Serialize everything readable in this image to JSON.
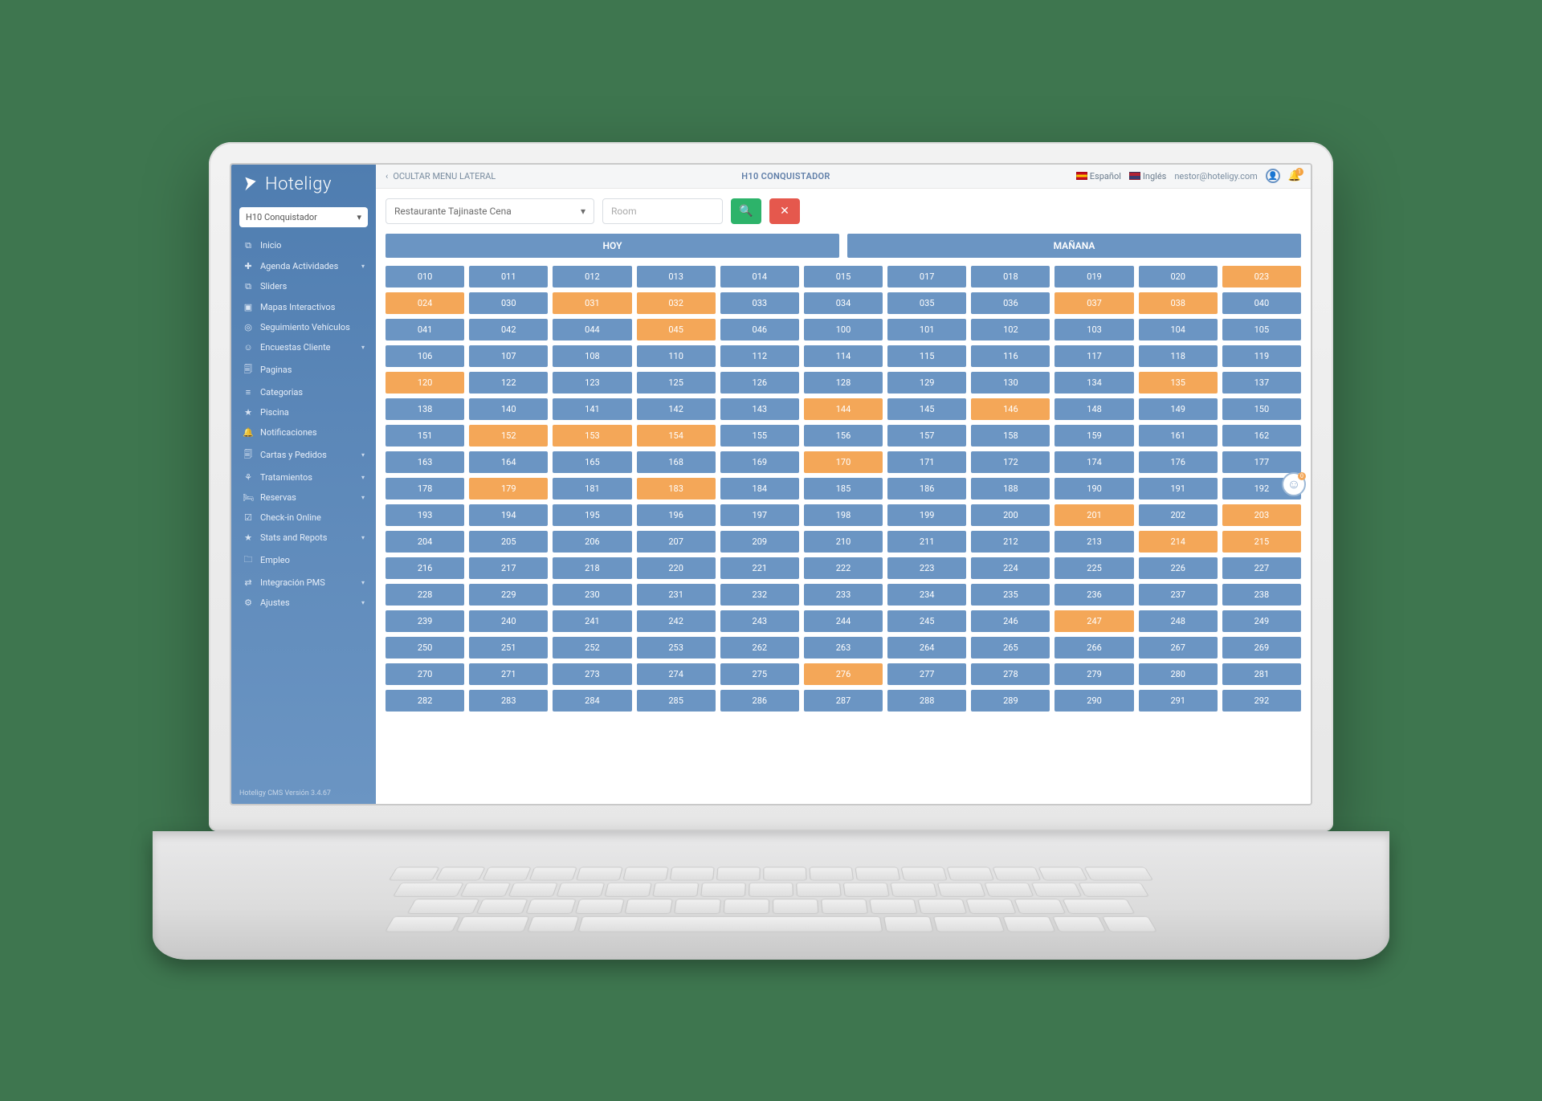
{
  "brand": "Hoteligy",
  "hotel_selector": "H10 Conquistador",
  "version": "Hoteligy CMS Versión 3.4.67",
  "topbar": {
    "toggle_label": "OCULTAR MENU LATERAL",
    "title": "H10 CONQUISTADOR",
    "lang1": "Español",
    "lang2": "Inglés",
    "user_email": "nestor@hoteligy.com",
    "bell_badge": "1"
  },
  "toolbar": {
    "select_value": "Restaurante Tajinaste Cena",
    "room_placeholder": "Room"
  },
  "day_headers": {
    "today": "HOY",
    "tomorrow": "MAÑANA"
  },
  "nav": [
    {
      "icon": "⧉",
      "label": "Inicio"
    },
    {
      "icon": "✚",
      "label": "Agenda Actividades",
      "exp": true
    },
    {
      "icon": "⧉",
      "label": "Sliders"
    },
    {
      "icon": "▣",
      "label": "Mapas Interactivos"
    },
    {
      "icon": "◎",
      "label": "Seguimiento Vehículos"
    },
    {
      "icon": "☺",
      "label": "Encuestas Cliente",
      "exp": true
    },
    {
      "icon": "🗐",
      "label": "Paginas"
    },
    {
      "icon": "≡",
      "label": "Categorias"
    },
    {
      "icon": "★",
      "label": "Piscina"
    },
    {
      "icon": "🔔",
      "label": "Notificaciones"
    },
    {
      "icon": "🗐",
      "label": "Cartas y Pedidos",
      "exp": true
    },
    {
      "icon": "⚘",
      "label": "Tratamientos",
      "exp": true
    },
    {
      "icon": "🛏",
      "label": "Reservas",
      "exp": true
    },
    {
      "icon": "☑",
      "label": "Check-in Online"
    },
    {
      "icon": "★",
      "label": "Stats and Repots",
      "exp": true
    },
    {
      "icon": "🗀",
      "label": "Empleo"
    },
    {
      "icon": "⇄",
      "label": "Integración PMS",
      "exp": true
    },
    {
      "icon": "⚙",
      "label": "Ajustes",
      "exp": true
    }
  ],
  "highlighted": [
    "023",
    "024",
    "031",
    "032",
    "037",
    "038",
    "045",
    "120",
    "135",
    "144",
    "146",
    "152",
    "153",
    "154",
    "170",
    "179",
    "183",
    "201",
    "203",
    "214",
    "215",
    "247",
    "276"
  ],
  "grid": [
    [
      "010",
      "011",
      "012",
      "013",
      "014",
      "015",
      "017",
      "018",
      "019",
      "020",
      "023"
    ],
    [
      "024",
      "030",
      "031",
      "032",
      "033",
      "034",
      "035",
      "036",
      "037",
      "038",
      "040"
    ],
    [
      "041",
      "042",
      "044",
      "045",
      "046",
      "100",
      "101",
      "102",
      "103",
      "104",
      "105"
    ],
    [
      "106",
      "107",
      "108",
      "110",
      "112",
      "114",
      "115",
      "116",
      "117",
      "118",
      "119"
    ],
    [
      "120",
      "122",
      "123",
      "125",
      "126",
      "128",
      "129",
      "130",
      "134",
      "135",
      "137"
    ],
    [
      "138",
      "140",
      "141",
      "142",
      "143",
      "144",
      "145",
      "146",
      "148",
      "149",
      "150"
    ],
    [
      "151",
      "152",
      "153",
      "154",
      "155",
      "156",
      "157",
      "158",
      "159",
      "161",
      "162"
    ],
    [
      "163",
      "164",
      "165",
      "168",
      "169",
      "170",
      "171",
      "172",
      "174",
      "176",
      "177"
    ],
    [
      "178",
      "179",
      "181",
      "183",
      "184",
      "185",
      "186",
      "188",
      "190",
      "191",
      "192"
    ],
    [
      "193",
      "194",
      "195",
      "196",
      "197",
      "198",
      "199",
      "200",
      "201",
      "202",
      "203"
    ],
    [
      "204",
      "205",
      "206",
      "207",
      "209",
      "210",
      "211",
      "212",
      "213",
      "214",
      "215"
    ],
    [
      "216",
      "217",
      "218",
      "220",
      "221",
      "222",
      "223",
      "224",
      "225",
      "226",
      "227"
    ],
    [
      "228",
      "229",
      "230",
      "231",
      "232",
      "233",
      "234",
      "235",
      "236",
      "237",
      "238"
    ],
    [
      "239",
      "240",
      "241",
      "242",
      "243",
      "244",
      "245",
      "246",
      "247",
      "248",
      "249"
    ],
    [
      "250",
      "251",
      "252",
      "253",
      "262",
      "263",
      "264",
      "265",
      "266",
      "267",
      "269"
    ],
    [
      "270",
      "271",
      "273",
      "274",
      "275",
      "276",
      "277",
      "278",
      "279",
      "280",
      "281"
    ],
    [
      "282",
      "283",
      "284",
      "285",
      "286",
      "287",
      "288",
      "289",
      "290",
      "291",
      "292"
    ]
  ],
  "fab_badge": "0"
}
